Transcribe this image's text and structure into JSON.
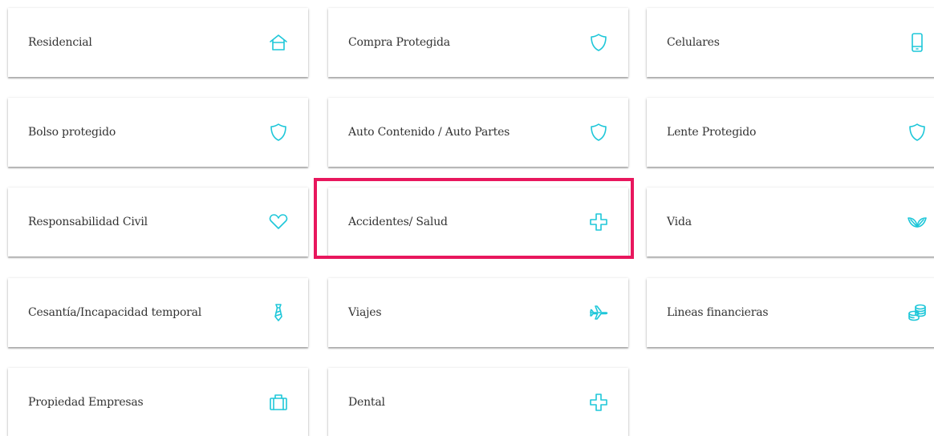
{
  "highlight_color": "#e8175d",
  "icon_color": "#1ec7d9",
  "cards": [
    {
      "label": "Residencial",
      "icon": "house-icon"
    },
    {
      "label": "Compra Protegida",
      "icon": "shield-icon"
    },
    {
      "label": "Celulares",
      "icon": "phone-icon"
    },
    {
      "label": "Bolso protegido",
      "icon": "shield-icon"
    },
    {
      "label": "Auto Contenido / Auto Partes",
      "icon": "shield-icon"
    },
    {
      "label": "Lente Protegido",
      "icon": "shield-icon"
    },
    {
      "label": "Responsabilidad Civil",
      "icon": "heart-icon"
    },
    {
      "label": "Accidentes/ Salud",
      "icon": "medical-cross-icon",
      "highlighted": true
    },
    {
      "label": "Vida",
      "icon": "leaves-icon"
    },
    {
      "label": "Cesantía/Incapacidad temporal",
      "icon": "tie-icon"
    },
    {
      "label": "Viajes",
      "icon": "airplane-icon"
    },
    {
      "label": "Lineas financieras",
      "icon": "coins-icon"
    },
    {
      "label": "Propiedad Empresas",
      "icon": "briefcase-icon"
    },
    {
      "label": "Dental",
      "icon": "medical-cross-icon"
    }
  ]
}
